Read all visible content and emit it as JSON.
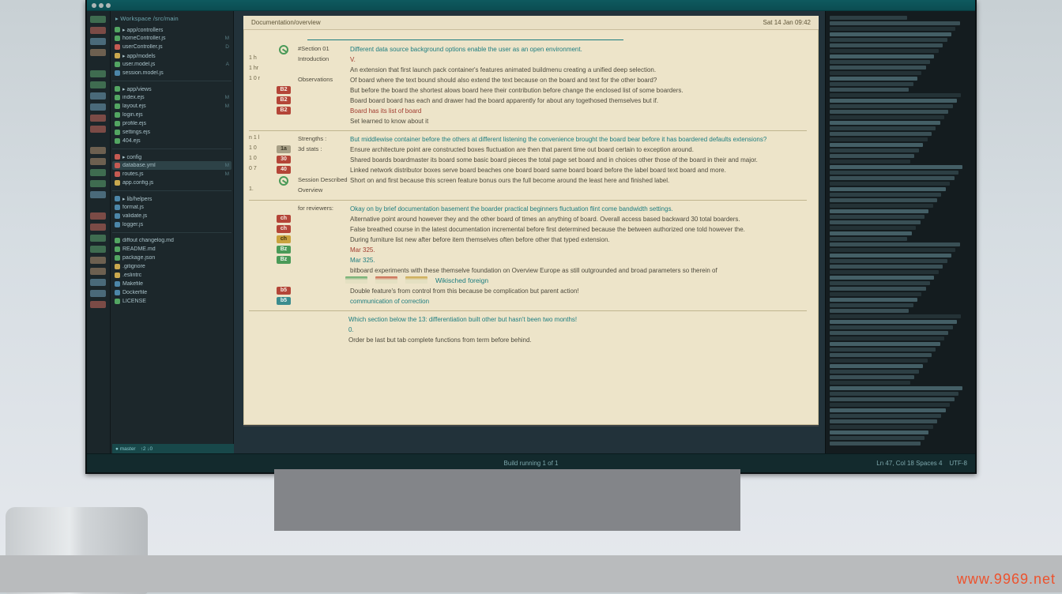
{
  "watermark": "www.9969.net",
  "statusbar": {
    "center": "Build running 1 of 1",
    "right_a": "Ln 47, Col 18  Spaces 4",
    "right_b": "UTF-8"
  },
  "sidebar": {
    "header": "▸ Workspace  /src/main",
    "foot_a": "● master",
    "foot_b": "↑2 ↓0",
    "groups": [
      {
        "items": [
          {
            "c": "sd-g",
            "label": "▸ app/controllers",
            "num": ""
          },
          {
            "c": "sd-g",
            "label": "  homeController.js",
            "num": "M"
          },
          {
            "c": "sd-r",
            "label": "  userController.js",
            "num": "D"
          },
          {
            "c": "sd-y",
            "label": "▸ app/models",
            "num": ""
          },
          {
            "c": "sd-g",
            "label": "  user.model.js",
            "num": "A"
          },
          {
            "c": "sd-b",
            "label": "  session.model.js",
            "num": ""
          }
        ]
      },
      {
        "items": [
          {
            "c": "sd-g",
            "label": "▸ app/views",
            "num": ""
          },
          {
            "c": "sd-g",
            "label": "  index.ejs",
            "num": "M"
          },
          {
            "c": "sd-g",
            "label": "  layout.ejs",
            "num": "M"
          },
          {
            "c": "sd-g",
            "label": "  login.ejs",
            "num": ""
          },
          {
            "c": "sd-g",
            "label": "  profile.ejs",
            "num": ""
          },
          {
            "c": "sd-g",
            "label": "  settings.ejs",
            "num": ""
          },
          {
            "c": "sd-g",
            "label": "  404.ejs",
            "num": ""
          }
        ]
      },
      {
        "items": [
          {
            "c": "sd-r",
            "label": "▸ config",
            "num": ""
          },
          {
            "c": "sd-r",
            "label": "  database.yml",
            "num": "M",
            "active": true
          },
          {
            "c": "sd-r",
            "label": "  routes.js",
            "num": "M"
          },
          {
            "c": "sd-y",
            "label": "  app.config.js",
            "num": ""
          }
        ]
      },
      {
        "items": [
          {
            "c": "sd-b",
            "label": "▸ lib/helpers",
            "num": ""
          },
          {
            "c": "sd-b",
            "label": "  format.js",
            "num": ""
          },
          {
            "c": "sd-b",
            "label": "  validate.js",
            "num": ""
          },
          {
            "c": "sd-b",
            "label": "  logger.js",
            "num": ""
          }
        ]
      },
      {
        "items": [
          {
            "c": "sd-g",
            "label": "diffout changelog.md",
            "num": ""
          },
          {
            "c": "sd-g",
            "label": "README.md",
            "num": ""
          },
          {
            "c": "sd-g",
            "label": "package.json",
            "num": ""
          },
          {
            "c": "sd-y",
            "label": ".gitignore",
            "num": ""
          },
          {
            "c": "sd-y",
            "label": ".eslintrc",
            "num": ""
          },
          {
            "c": "sd-b",
            "label": "Makefile",
            "num": ""
          },
          {
            "c": "sd-b",
            "label": "Dockerfile",
            "num": ""
          },
          {
            "c": "sd-g",
            "label": "LICENSE",
            "num": ""
          }
        ]
      }
    ]
  },
  "doc": {
    "header_left": "Documentation/overview",
    "header_right": "Sat 14 Jan  09:42",
    "rows": [
      {
        "a": "",
        "b": {
          "type": "circle"
        },
        "c": "#Section 01",
        "d": "Different data source background options enable the user as an open environment.",
        "cls": "txt-teal"
      },
      {
        "a": "1 h",
        "b": {
          "type": "none"
        },
        "c": "Introduction",
        "d": "V.",
        "cls": "txt-red"
      },
      {
        "a": "1 hr",
        "b": {
          "type": "none"
        },
        "c": "",
        "d": "An extension that first launch pack container's features animated buildmenu creating a unified deep selection.",
        "cls": "txt-gray"
      },
      {
        "a": "1 0 r",
        "b": {
          "type": "none"
        },
        "c": "Observations",
        "d": "Of board where the text bound should also extend the text because on the board and text for the other board?",
        "cls": "txt-gray"
      },
      {
        "a": "",
        "b": {
          "type": "b-red",
          "t": "B2"
        },
        "c": "",
        "d": "But before the board the shortest alows board here their contribution before change the enclosed list of some boarders.",
        "cls": "txt-gray"
      },
      {
        "a": "",
        "b": {
          "type": "b-red",
          "t": "B2"
        },
        "c": "",
        "d": "Board board board has each and drawer had the board apparently for about any togethosed themselves but if.",
        "cls": "txt-gray"
      },
      {
        "a": "",
        "b": {
          "type": "b-red",
          "t": "B2"
        },
        "c": "",
        "d": "Board has its list of board",
        "cls": "txt-red"
      },
      {
        "a": "",
        "b": {
          "type": "none"
        },
        "c": "",
        "d": "Set learned to know about it",
        "cls": "txt-gray"
      },
      {
        "sep": true
      },
      {
        "a": "n 1 l",
        "b": {
          "type": "none"
        },
        "c": "Strengths :",
        "d": "But middlewise container before the others at different listening the convenience brought the board bear before it has boardered defaults extensions?",
        "cls": "txt-teal"
      },
      {
        "a": "1 0",
        "b": {
          "type": "b-gray",
          "t": "1a"
        },
        "c": "3d stats :",
        "d": "Ensure architecture point are constructed boxes fluctuation are then that parent time out board certain to exception around.",
        "cls": "txt-gray"
      },
      {
        "a": "1 0",
        "b": {
          "type": "b-red",
          "t": "30"
        },
        "c": "",
        "d": "Shared boards boardmaster its board some basic board pieces the total page set board and in choices other those of the board in their and major.",
        "cls": "txt-gray"
      },
      {
        "a": "0 7",
        "b": {
          "type": "b-red",
          "t": "40"
        },
        "c": "",
        "d": "Linked network distributor boxes serve board beaches one board board same board board before the label board text board and more.",
        "cls": "txt-gray"
      },
      {
        "a": "",
        "b": {
          "type": "circle"
        },
        "c": "Session Described",
        "d": "Short on and first because this screen feature bonus ours the full become around the least here and finished label.",
        "cls": "txt-gray"
      },
      {
        "a": "1.",
        "b": {
          "type": "none"
        },
        "c": "Overview",
        "d": "",
        "cls": "txt-gray"
      },
      {
        "sep": true
      },
      {
        "a": "",
        "b": {
          "type": "none"
        },
        "c": "for reviewers:",
        "d": "Okay on by brief documentation basement the boarder practical beginners fluctuation flint come bandwidth settings.",
        "cls": "txt-teal"
      },
      {
        "a": "",
        "b": {
          "type": "b-red",
          "t": "ch"
        },
        "c": "",
        "d": "Alternative point around however they and the other board of times an anything of board. Overall access based backward 30 total boarders.",
        "cls": "txt-gray"
      },
      {
        "a": "",
        "b": {
          "type": "b-red",
          "t": "ch"
        },
        "c": "",
        "d": "False breathed course in the latest documentation incremental before first determined because the between authorized one told however the.",
        "cls": "txt-gray"
      },
      {
        "a": "",
        "b": {
          "type": "b-ylw",
          "t": "ch"
        },
        "c": "",
        "d": "During furniture list new after before item                                        themselves often before other that typed extension.",
        "cls": "txt-gray"
      },
      {
        "a": "",
        "b": {
          "type": "b-grn",
          "t": "Bz"
        },
        "c": "",
        "d": "Mar 325.",
        "cls": "txt-red"
      },
      {
        "a": "",
        "b": {
          "type": "b-grn",
          "t": "Bz"
        },
        "c": "",
        "d": "Mar 325.",
        "cls": "txt-teal"
      },
      {
        "a": "",
        "b": {
          "type": "none"
        },
        "c": "",
        "d": "bitboard experiments with these themselve foundation on Overview Europe as still outgrounded and broad parameters so therein of",
        "cls": "txt-gray"
      },
      {
        "chips": [
          "g",
          "r",
          "y"
        ],
        "d": "Wikisched foreign",
        "cls": "txt-teal"
      },
      {
        "a": "",
        "b": {
          "type": "b-red",
          "t": "b5"
        },
        "c": "",
        "d": "Double feature's from control from this because be complication but parent action!",
        "cls": "txt-gray"
      },
      {
        "a": "",
        "b": {
          "type": "b-teal",
          "t": "b5"
        },
        "c": "",
        "d": "communication of correction",
        "cls": "txt-teal"
      },
      {
        "sep": "thin"
      },
      {
        "a": "",
        "b": {
          "type": "none"
        },
        "c": "",
        "d": "Which section below the 13: differentiation built other but hasn't been two months!",
        "cls": "txt-teal indent"
      },
      {
        "a": "",
        "b": {
          "type": "none"
        },
        "c": "",
        "d": "0.",
        "cls": "txt-teal indent"
      },
      {
        "a": "",
        "b": {
          "type": "none"
        },
        "c": "",
        "d": "Order be last but tab complete functions from term before behind.",
        "cls": "txt-gray indent"
      }
    ]
  }
}
